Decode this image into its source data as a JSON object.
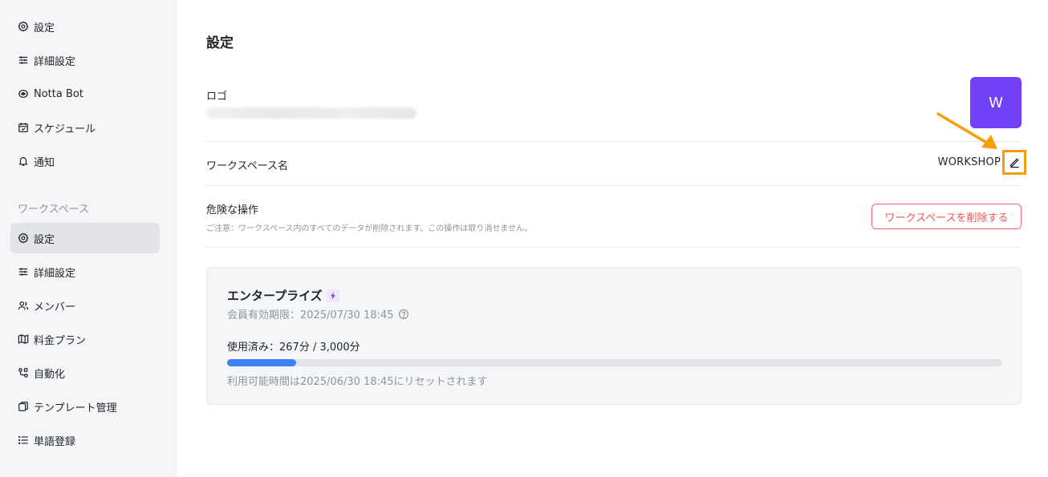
{
  "sidebar": {
    "top_items": [
      {
        "label": "設定",
        "icon": "gear-icon"
      },
      {
        "label": "詳細設定",
        "icon": "sliders-icon"
      },
      {
        "label": "Notta Bot",
        "icon": "bot-icon"
      },
      {
        "label": "スケジュール",
        "icon": "calendar-icon"
      },
      {
        "label": "通知",
        "icon": "bell-icon"
      }
    ],
    "section_label": "ワークスペース",
    "workspace_items": [
      {
        "label": "設定",
        "icon": "gear-icon",
        "active": true
      },
      {
        "label": "詳細設定",
        "icon": "sliders-icon"
      },
      {
        "label": "メンバー",
        "icon": "users-icon"
      },
      {
        "label": "料金プラン",
        "icon": "map-icon"
      },
      {
        "label": "自動化",
        "icon": "workflow-icon"
      },
      {
        "label": "テンプレート管理",
        "icon": "template-icon"
      },
      {
        "label": "単語登録",
        "icon": "list-icon"
      }
    ]
  },
  "main": {
    "title": "設定",
    "logo": {
      "label": "ロゴ",
      "initial": "W",
      "color": "#7240f6"
    },
    "workspace_name": {
      "label": "ワークスペース名",
      "value": "WORKSHOP",
      "edit_icon": "pencil-icon"
    },
    "danger": {
      "label": "危険な操作",
      "note": "ご注意：ワークスペース内のすべてのデータが削除されます。この操作は取り消せません。",
      "delete_button": "ワークスペースを削除する"
    },
    "plan": {
      "name": "エンタープライズ",
      "expiry": "会員有効期限：2025/07/30 18:45",
      "usage": "使用済み：267分 / 3,000分",
      "used_minutes": 267,
      "total_minutes": 3000,
      "reset": "利用可能時間は2025/06/30 18:45にリセットされます"
    }
  },
  "colors": {
    "accent": "#7240f6",
    "danger": "#f05454",
    "highlight": "#f59e0b",
    "progress": "#3b82f6"
  }
}
